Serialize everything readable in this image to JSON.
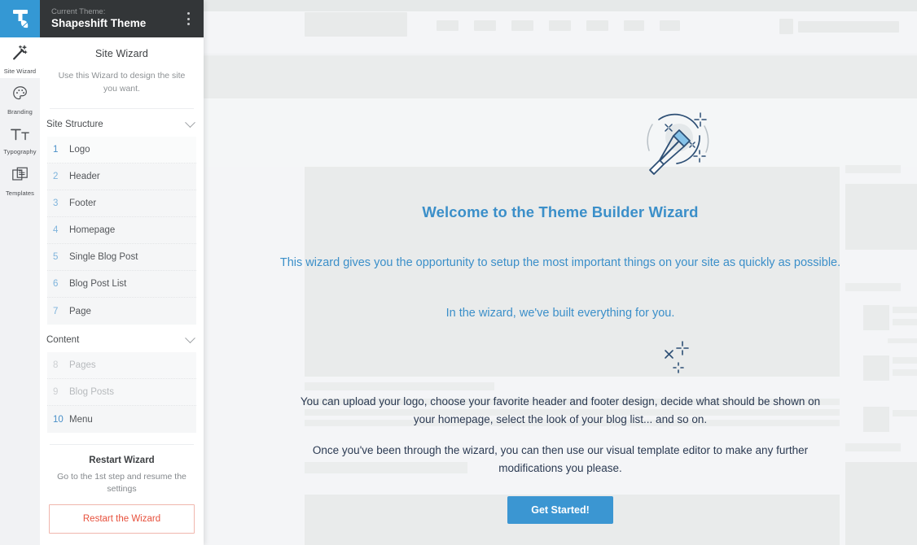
{
  "rail": {
    "logo_icon": "themify-logo-icon",
    "items": [
      {
        "label": "Site Wizard",
        "icon": "magic-wand-icon",
        "active": true
      },
      {
        "label": "Branding",
        "icon": "palette-icon",
        "active": false
      },
      {
        "label": "Typography",
        "icon": "typography-tt-icon",
        "active": false
      },
      {
        "label": "Templates",
        "icon": "templates-icon",
        "active": false
      }
    ]
  },
  "panel": {
    "topbar": {
      "current_theme_label": "Current Theme:",
      "theme_name": "Shapeshift Theme",
      "menu_icon": "kebab-menu-icon"
    },
    "title": "Site Wizard",
    "subtitle": "Use this Wizard to design the site you want.",
    "groups": [
      {
        "name": "Site Structure",
        "collapse_icon": "chevron-down-icon",
        "steps": [
          {
            "num": "1",
            "label": "Logo",
            "disabled": false
          },
          {
            "num": "2",
            "label": "Header",
            "disabled": false
          },
          {
            "num": "3",
            "label": "Footer",
            "disabled": false
          },
          {
            "num": "4",
            "label": "Homepage",
            "disabled": false
          },
          {
            "num": "5",
            "label": "Single Blog Post",
            "disabled": false
          },
          {
            "num": "6",
            "label": "Blog Post List",
            "disabled": false
          },
          {
            "num": "7",
            "label": "Page",
            "disabled": false
          }
        ]
      },
      {
        "name": "Content",
        "collapse_icon": "chevron-down-icon",
        "steps": [
          {
            "num": "8",
            "label": "Pages",
            "disabled": true
          },
          {
            "num": "9",
            "label": "Blog Posts",
            "disabled": true
          },
          {
            "num": "10",
            "label": "Menu",
            "disabled": false
          }
        ]
      }
    ],
    "restart": {
      "title": "Restart Wizard",
      "subtitle": "Go to the 1st step and resume the settings",
      "button_label": "Restart the Wizard"
    }
  },
  "main": {
    "illustration_icon": "magic-wand-illustration",
    "sparkles_icon": "sparkles-icon",
    "heading": "Welcome to the Theme Builder Wizard",
    "paragraph_1": "This wizard gives you the opportunity to setup the most important things on your site as quickly as possible.",
    "paragraph_2": "In the wizard, we've built everything for you.",
    "paragraph_3": "You can upload your logo, choose your favorite header and footer design, decide what should be shown on your homepage, select the look of your blog list... and so on.",
    "paragraph_4": "Once you've been through the wizard, you can then use our visual template editor to make any further modifications you please.",
    "cta_label": "Get Started!"
  },
  "colors": {
    "brand_blue": "#3b96d2",
    "logo_blue": "#3498d4",
    "topbar_dark": "#333638",
    "heading_blue": "#3b8fc9",
    "body_navy": "#2b3a52",
    "restart_red": "#e7503c"
  }
}
